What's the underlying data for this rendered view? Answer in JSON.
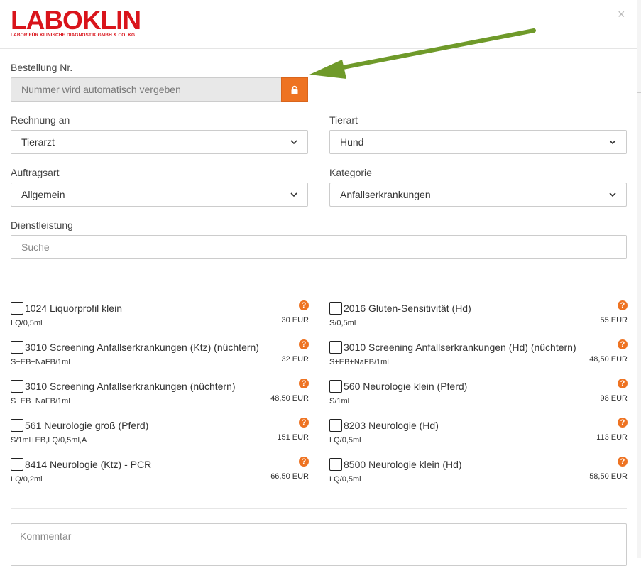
{
  "logo": {
    "name": "LABOKLIN",
    "subtitle": "LABOR FÜR KLINISCHE DIAGNOSTIK GMBH & CO. KG"
  },
  "close_label": "×",
  "order": {
    "label": "Bestellung Nr.",
    "placeholder": "Nummer wird automatisch vergeben",
    "lock_icon": "unlock-icon"
  },
  "invoice": {
    "label": "Rechnung an",
    "value": "Tierarzt"
  },
  "animal": {
    "label": "Tierart",
    "value": "Hund"
  },
  "order_type": {
    "label": "Auftragsart",
    "value": "Allgemein"
  },
  "category": {
    "label": "Kategorie",
    "value": "Anfallserkrankungen"
  },
  "service": {
    "label": "Dienstleistung",
    "placeholder": "Suche"
  },
  "services": [
    {
      "name": "1024 Liquorprofil klein",
      "sample": "LQ/0,5ml",
      "price": "30 EUR"
    },
    {
      "name": "2016 Gluten-Sensitivität (Hd)",
      "sample": "S/0,5ml",
      "price": "55 EUR"
    },
    {
      "name": "3010 Screening Anfallserkrankungen (Ktz) (nüchtern)",
      "sample": "S+EB+NaFB/1ml",
      "price": "32 EUR"
    },
    {
      "name": "3010 Screening Anfallserkrankungen (Hd) (nüchtern)",
      "sample": "S+EB+NaFB/1ml",
      "price": "48,50 EUR"
    },
    {
      "name": "3010 Screening Anfallserkrankungen (nüchtern)",
      "sample": "S+EB+NaFB/1ml",
      "price": "48,50 EUR"
    },
    {
      "name": "560 Neurologie klein (Pferd)",
      "sample": "S/1ml",
      "price": "98 EUR"
    },
    {
      "name": "561 Neurologie groß (Pferd)",
      "sample": "S/1ml+EB,LQ/0,5ml,A",
      "price": "151 EUR"
    },
    {
      "name": "8203 Neurologie (Hd)",
      "sample": "LQ/0,5ml",
      "price": "113 EUR"
    },
    {
      "name": "8414 Neurologie (Ktz) - PCR",
      "sample": "LQ/0,2ml",
      "price": "66,50 EUR"
    },
    {
      "name": "8500 Neurologie klein (Hd)",
      "sample": "LQ/0,5ml",
      "price": "58,50 EUR"
    }
  ],
  "help_icon_label": "?",
  "comment": {
    "placeholder": "Kommentar"
  },
  "colors": {
    "brand": "#d9141b",
    "accent": "#ee7322",
    "arrow": "#6f9a2a"
  }
}
